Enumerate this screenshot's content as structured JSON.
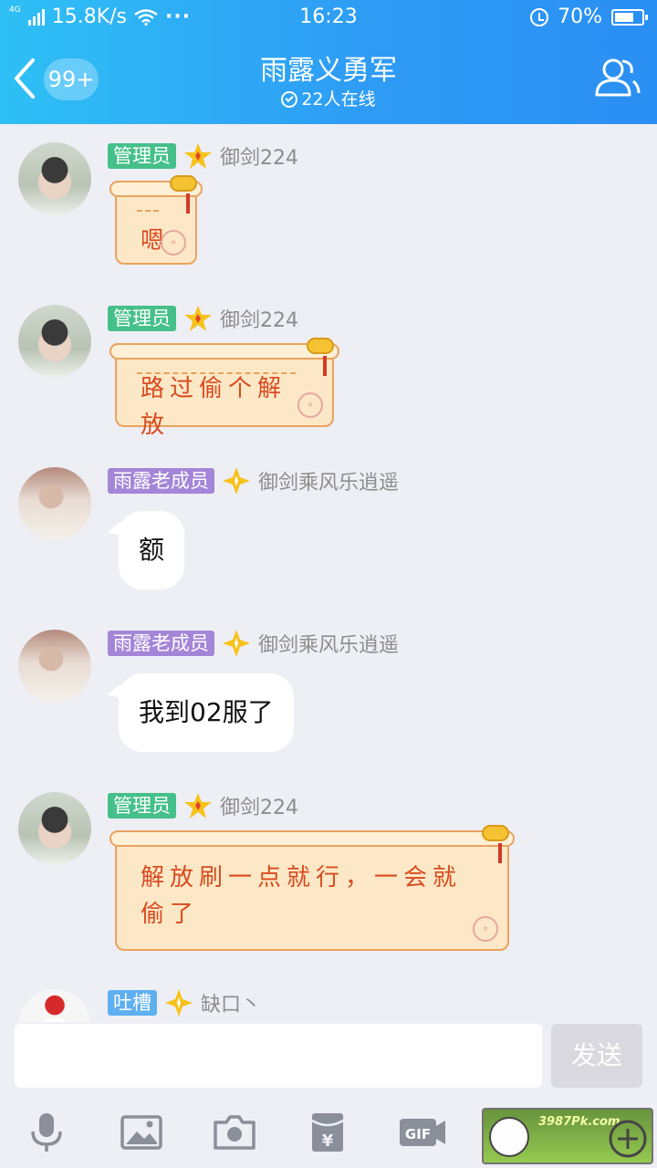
{
  "status_bar": {
    "net_type": "4G",
    "speed": "15.8K/s",
    "more": "···",
    "time": "16:23",
    "battery": "70%",
    "battery_level": 0.7
  },
  "header": {
    "unread_badge": "99+",
    "title": "雨露义勇军",
    "online": "22人在线"
  },
  "messages": [
    {
      "role": "管理员",
      "name": "御剑224",
      "text": "嗯",
      "style": "scroll"
    },
    {
      "role": "管理员",
      "name": "御剑224",
      "text": "路过偷个解放",
      "style": "scroll"
    },
    {
      "role": "雨露老成员",
      "name": "御剑乘风乐逍遥",
      "text": "额",
      "style": "plain"
    },
    {
      "role": "雨露老成员",
      "name": "御剑乘风乐逍遥",
      "text": "我到02服了",
      "style": "plain"
    },
    {
      "role": "管理员",
      "name": "御剑224",
      "text": "解放刷一点就行，一会就偷了",
      "style": "scroll"
    },
    {
      "role": "吐槽",
      "name": "缺口丶",
      "text": "",
      "style": "plain"
    }
  ],
  "input": {
    "value": "",
    "send_label": "发送"
  },
  "toolbar": {
    "icons": [
      "microphone-icon",
      "image-icon",
      "camera-icon",
      "red-packet-icon",
      "gif-icon",
      "plus-icon"
    ]
  },
  "watermark": {
    "text": "3987Pk.com"
  },
  "colors": {
    "header_gradient": [
      "#2ec0f5",
      "#2a8ff3"
    ],
    "admin_tag": "#45c08a",
    "elder_tag": "#a486d8",
    "roast_tag": "#5fb0f0",
    "scroll_text": "#d94a1f"
  }
}
